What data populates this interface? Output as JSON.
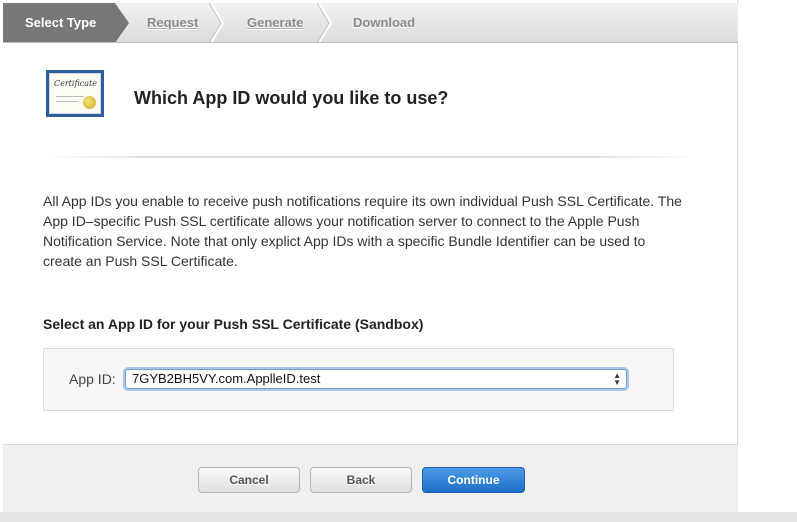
{
  "steps": [
    {
      "label": "Select Type",
      "active": true
    },
    {
      "label": "Request",
      "active": false
    },
    {
      "label": "Generate",
      "active": false
    },
    {
      "label": "Download",
      "active": false
    }
  ],
  "header": {
    "icon_word": "Certificate",
    "title": "Which App ID would you like to use?"
  },
  "description": "All App IDs you enable to receive push notifications require its own individual Push SSL Certificate. The App ID–specific Push SSL certificate allows your notification server to connect to the Apple Push Notification Service. Note that only explict App IDs with a specific Bundle Identifier can be used to create an Push SSL Certificate.",
  "select_section": {
    "label": "Select an App ID for your Push SSL Certificate (Sandbox)",
    "field_label": "App ID:",
    "selected_value": "7GYB2BH5VY.com.ApplleID.test"
  },
  "footer": {
    "cancel_label": "Cancel",
    "back_label": "Back",
    "continue_label": "Continue"
  },
  "colors": {
    "active_step": "#777777",
    "primary_button": "#2f80d6"
  }
}
